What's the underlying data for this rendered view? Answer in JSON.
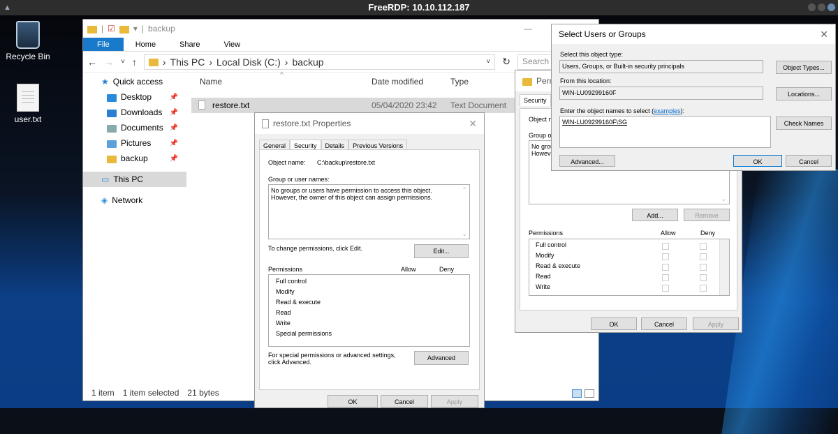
{
  "topbar": {
    "title": "FreeRDP: 10.10.112.187"
  },
  "desktop": {
    "recycle_bin": "Recycle Bin",
    "user_file": "user.txt"
  },
  "explorer": {
    "title": "backup",
    "ribbon_tabs": [
      "File",
      "Home",
      "Share",
      "View"
    ],
    "breadcrumb": [
      "This PC",
      "Local Disk (C:)",
      "backup"
    ],
    "search_placeholder": "Search backup",
    "nav": [
      {
        "label": "Quick access"
      },
      {
        "label": "Desktop"
      },
      {
        "label": "Downloads"
      },
      {
        "label": "Documents"
      },
      {
        "label": "Pictures"
      },
      {
        "label": "backup"
      },
      {
        "label": "This PC"
      },
      {
        "label": "Network"
      }
    ],
    "columns": [
      "Name",
      "Date modified",
      "Type"
    ],
    "file": {
      "name": "restore.txt",
      "date": "05/04/2020 23:42",
      "type": "Text Document"
    },
    "status": {
      "count": "1 item",
      "selected": "1 item selected",
      "size": "21 bytes"
    }
  },
  "properties": {
    "title": "restore.txt Properties",
    "tabs": [
      "General",
      "Security",
      "Details",
      "Previous Versions"
    ],
    "object_name_label": "Object name:",
    "object_name": "C:\\backup\\restore.txt",
    "group_label": "Group or user names:",
    "no_groups": "No groups or users have permission to access this object.",
    "owner_note": "However, the owner of this object can assign permissions.",
    "change_text": "To change permissions, click Edit.",
    "edit": "Edit...",
    "permissions_label": "Permissions",
    "allow": "Allow",
    "deny": "Deny",
    "perms": [
      "Full control",
      "Modify",
      "Read & execute",
      "Read",
      "Write",
      "Special permissions"
    ],
    "special_text": "For special permissions or advanced settings, click Advanced.",
    "advanced": "Advanced",
    "ok": "OK",
    "cancel": "Cancel",
    "apply": "Apply"
  },
  "perm_dialog": {
    "title": "Permi",
    "tab": "Security",
    "object_label": "Object n",
    "group_label": "Group or",
    "no_groups": "No grou",
    "however": "Howeve",
    "add": "Add...",
    "remove": "Remove",
    "permissions_label": "Permissions",
    "allow": "Allow",
    "deny": "Deny",
    "perms": [
      "Full control",
      "Modify",
      "Read & execute",
      "Read",
      "Write"
    ],
    "ok": "OK",
    "cancel": "Cancel",
    "apply": "Apply"
  },
  "select_dialog": {
    "title": "Select Users or Groups",
    "type_label": "Select this object type:",
    "type_value": "Users, Groups, or Built-in security principals",
    "object_types": "Object Types...",
    "location_label": "From this location:",
    "location_value": "WIN-LU09299160F",
    "locations": "Locations...",
    "enter_label": "Enter the object names to select (",
    "examples": "examples",
    "enter_suffix": "):",
    "entered": "WIN-LU09299160F\\SG",
    "check_names": "Check Names",
    "advanced": "Advanced...",
    "ok": "OK",
    "cancel": "Cancel"
  }
}
